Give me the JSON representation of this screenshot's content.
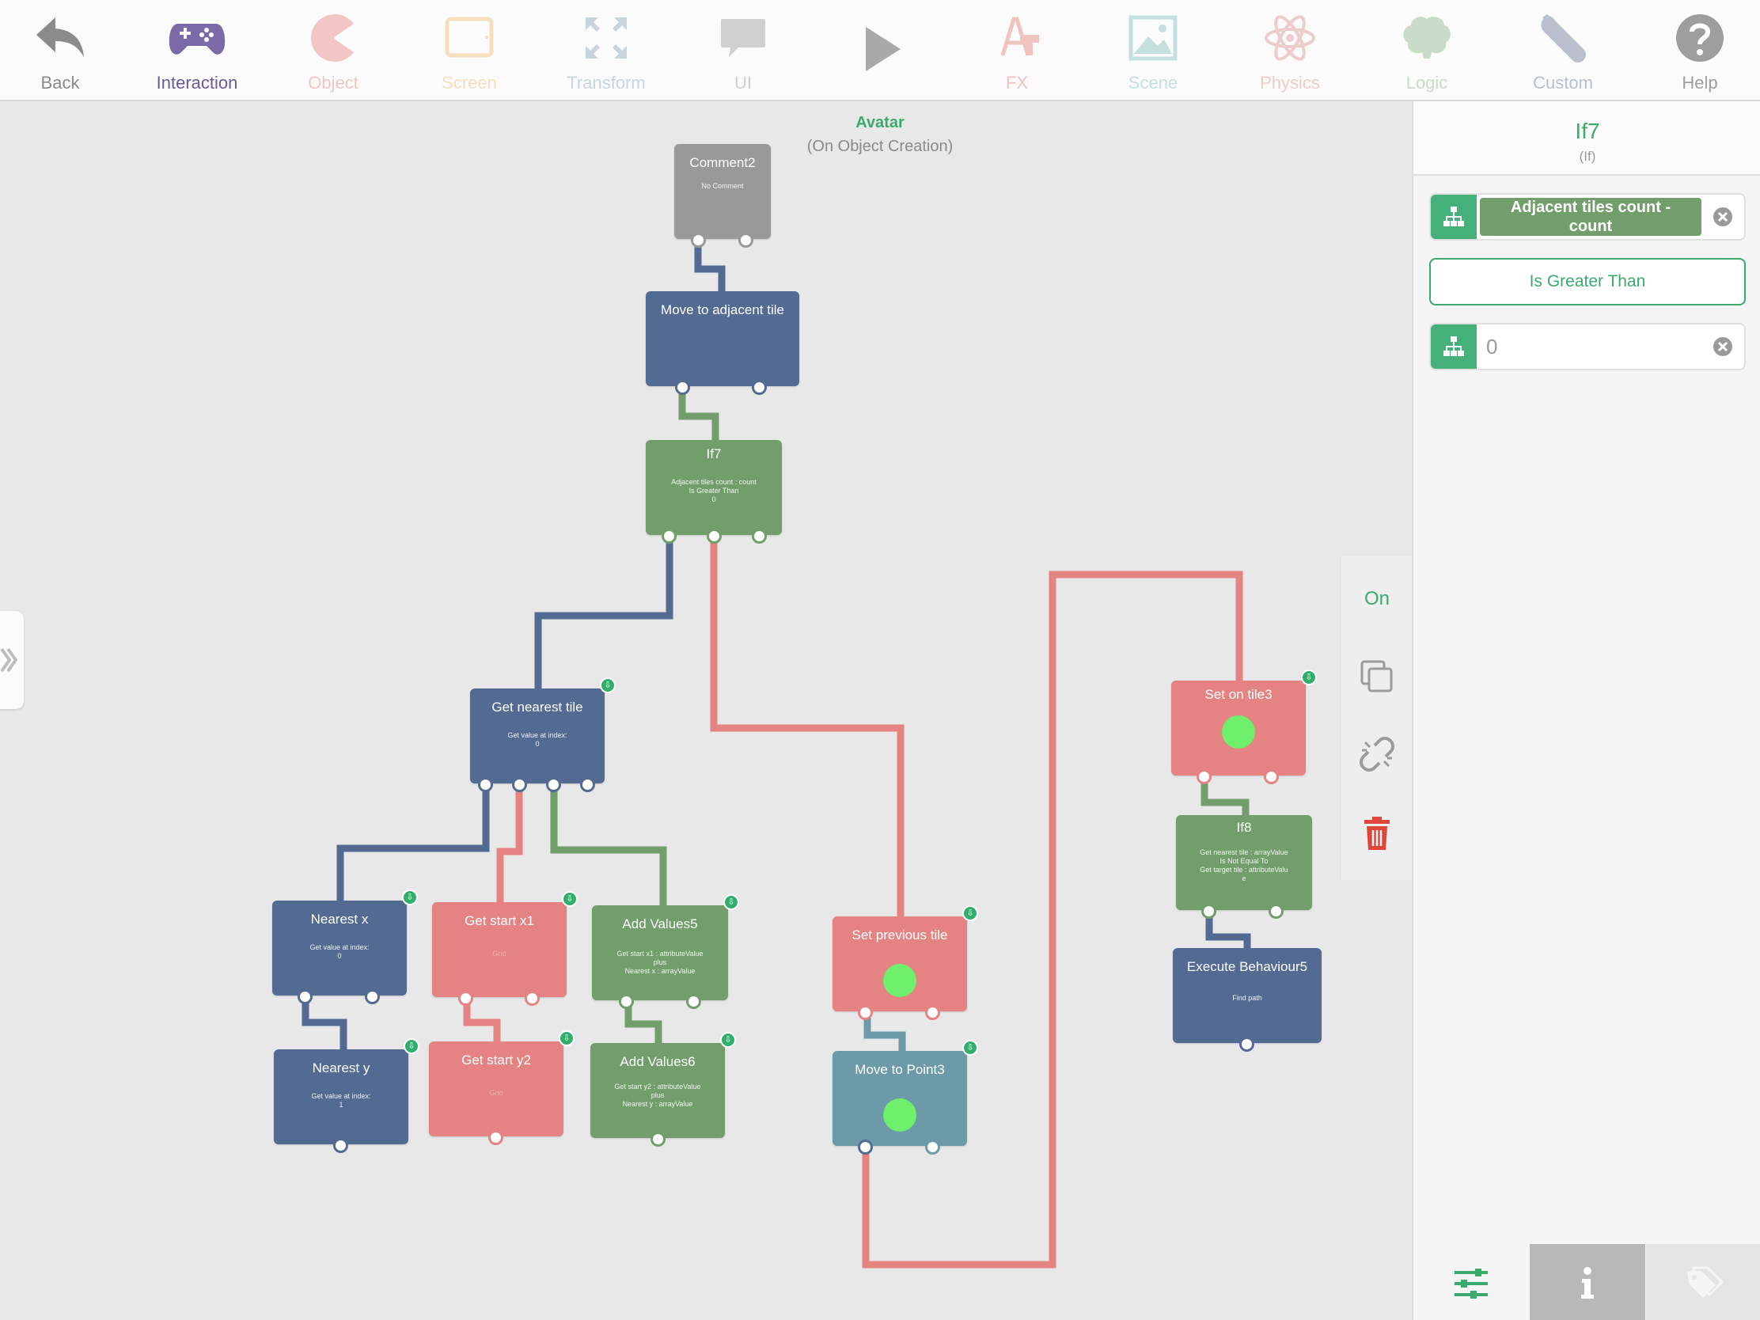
{
  "toolbar": {
    "items": [
      {
        "label": "Back",
        "icon": "back-arrow-icon",
        "color": "#8b8b8b"
      },
      {
        "label": "Interaction",
        "icon": "gamepad-icon",
        "color": "#7a6aa8"
      },
      {
        "label": "Object",
        "icon": "pacman-icon",
        "color": "#f3c6c6"
      },
      {
        "label": "Screen",
        "icon": "tablet-icon",
        "color": "#f5dfbf"
      },
      {
        "label": "Transform",
        "icon": "expand-arrows-icon",
        "color": "#c8d5dc"
      },
      {
        "label": "UI",
        "icon": "speech-bubble-icon",
        "color": "#cfcfcf"
      },
      {
        "label": "",
        "icon": "play-icon",
        "color": "#a9a9a9"
      },
      {
        "label": "FX",
        "icon": "fx-brush-icon",
        "color": "#f0c3c0"
      },
      {
        "label": "Scene",
        "icon": "image-icon",
        "color": "#c4e0dc"
      },
      {
        "label": "Physics",
        "icon": "atom-icon",
        "color": "#edcdcb"
      },
      {
        "label": "Logic",
        "icon": "brain-icon",
        "color": "#c8dcc9"
      },
      {
        "label": "Custom",
        "icon": "wrench-icon",
        "color": "#b9bfcc"
      },
      {
        "label": "Help",
        "icon": "help-circle-icon",
        "color": "#9e9e9e"
      }
    ]
  },
  "canvas": {
    "object_name": "Avatar",
    "event": "(On Object Creation)"
  },
  "nodes": {
    "comment2": {
      "title": "Comment2",
      "sub": "No Comment"
    },
    "move_adjacent": {
      "title": "Move to adjacent tile",
      "sub": ""
    },
    "if7": {
      "title": "If7",
      "sub": "Adjacent tiles count : count\nIs Greater Than\n0"
    },
    "get_nearest": {
      "title": "Get nearest tile",
      "sub": "Get value at index:\n0"
    },
    "nearest_x": {
      "title": "Nearest x",
      "sub": "Get value at index:\n0"
    },
    "nearest_y": {
      "title": "Nearest y",
      "sub": "Get value at index:\n1"
    },
    "get_start_x1": {
      "title": "Get start x1",
      "sub": "Grid"
    },
    "get_start_y2": {
      "title": "Get start y2",
      "sub": "Grid"
    },
    "add_values5": {
      "title": "Add Values5",
      "sub": "Get start x1 : attributeValue\nplus\nNearest x : arrayValue"
    },
    "add_values6": {
      "title": "Add Values6",
      "sub": "Get start y2 : attributeValue\nplus\nNearest y : arrayValue"
    },
    "set_previous": {
      "title": "Set previous tile",
      "sub": ""
    },
    "move_point3": {
      "title": "Move to Point3",
      "sub": ""
    },
    "set_on_tile3": {
      "title": "Set on tile3",
      "sub": ""
    },
    "if8": {
      "title": "If8",
      "sub": "Get nearest tile : arrayValue\nIs Not Equal To\nGet target tile : attributeValu\ne"
    },
    "exec5": {
      "title": "Execute Behaviour5",
      "sub": "Find path"
    }
  },
  "actions": {
    "on_label": "On",
    "items": [
      "duplicate-icon",
      "unlink-icon",
      "trash-icon"
    ]
  },
  "panel": {
    "title": "If7",
    "subtitle": "(If)",
    "left_operand": "Adjacent tiles count - count",
    "operator": "Is Greater Than",
    "right_operand": "0",
    "accent": "#3aaa6f",
    "tabs": [
      "sliders-icon",
      "info-icon",
      "tag-icon"
    ]
  }
}
